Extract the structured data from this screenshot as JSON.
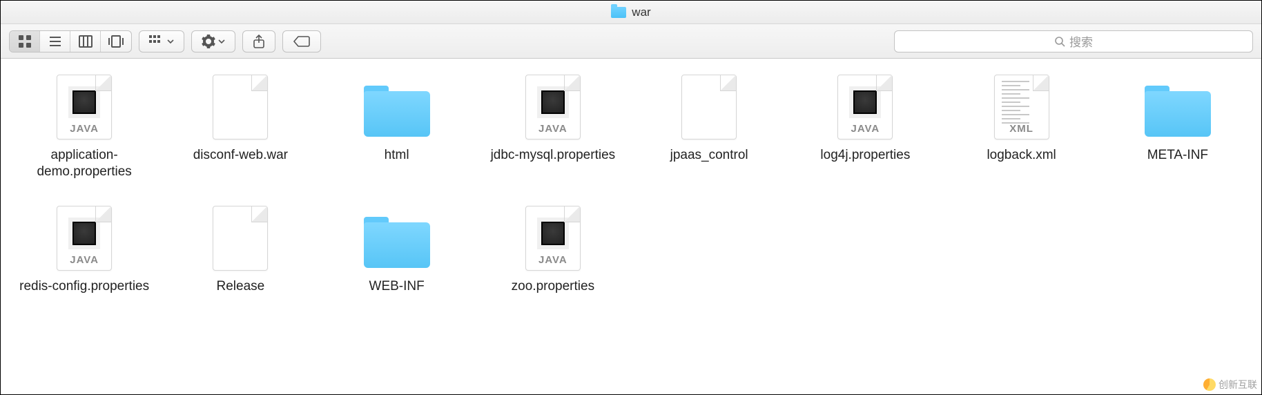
{
  "window": {
    "title": "war"
  },
  "toolbar": {
    "view_icon": "icon-view",
    "view_list": "list-view",
    "view_columns": "column-view",
    "view_gallery": "gallery-view",
    "group": "group-by",
    "action": "action",
    "share": "share",
    "tags": "edit-tags"
  },
  "search": {
    "placeholder": "搜索"
  },
  "items": [
    {
      "name": "application-demo.properties",
      "type": "java"
    },
    {
      "name": "disconf-web.war",
      "type": "blank"
    },
    {
      "name": "html",
      "type": "folder"
    },
    {
      "name": "jdbc-mysql.properties",
      "type": "java"
    },
    {
      "name": "jpaas_control",
      "type": "blank"
    },
    {
      "name": "log4j.properties",
      "type": "java"
    },
    {
      "name": "logback.xml",
      "type": "xml"
    },
    {
      "name": "META-INF",
      "type": "folder"
    },
    {
      "name": "redis-config.properties",
      "type": "java"
    },
    {
      "name": "Release",
      "type": "blank"
    },
    {
      "name": "WEB-INF",
      "type": "folder"
    },
    {
      "name": "zoo.properties",
      "type": "java"
    }
  ],
  "badges": {
    "java": "JAVA",
    "xml": "XML"
  },
  "watermark": "创新互联"
}
